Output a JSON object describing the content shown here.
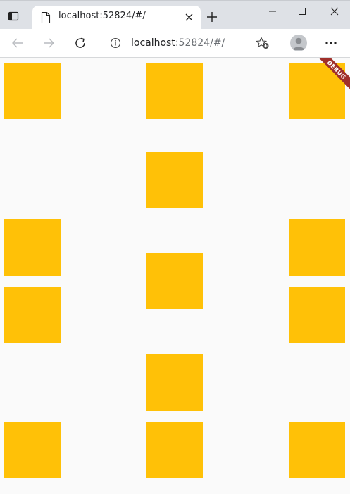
{
  "browser": {
    "tab": {
      "title": "localhost:52824/#/"
    },
    "address": {
      "host": "localhost",
      "rest": ":52824/#/"
    }
  },
  "app": {
    "debug_label": "DEBUG",
    "box_color": "#ffc107",
    "banner_color": "#a0302b",
    "background": "#fafafa"
  },
  "icons": {
    "tab_actions": "tab-actions-icon",
    "favicon": "page-icon",
    "close": "close-icon",
    "new_tab": "plus-icon",
    "minimize": "minimize-icon",
    "maximize": "maximize-icon",
    "window_close": "close-icon",
    "back": "back-arrow-icon",
    "forward": "forward-arrow-icon",
    "refresh": "refresh-icon",
    "info": "info-icon",
    "favorites": "add-favorite-icon",
    "profile": "profile-avatar-icon",
    "more": "more-icon"
  }
}
